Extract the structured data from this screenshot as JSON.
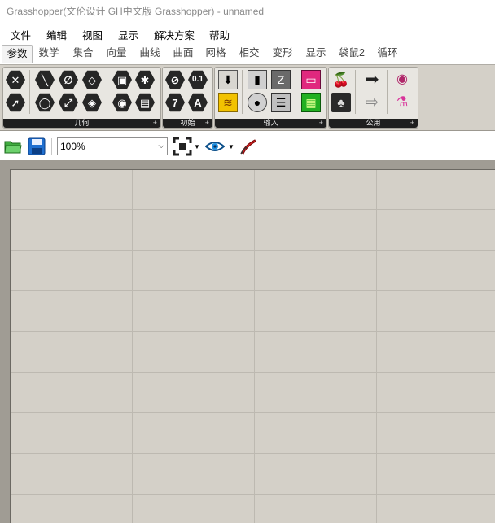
{
  "window": {
    "title": "Grasshopper(文伦设计 GH中文版 Grasshopper) - unnamed"
  },
  "menu": [
    "文件",
    "编辑",
    "视图",
    "显示",
    "解决方案",
    "帮助"
  ],
  "tabs": [
    "参数",
    "数学",
    "集合",
    "向量",
    "曲线",
    "曲面",
    "网格",
    "相交",
    "变形",
    "显示",
    "袋鼠2",
    "循环"
  ],
  "active_tab": "参数",
  "ribbon": {
    "panels": [
      {
        "label": "几何"
      },
      {
        "label": "初始"
      },
      {
        "label": "输入"
      },
      {
        "label": "公用"
      }
    ],
    "glyphs": {
      "num": "0.1",
      "seven": "7",
      "letter_a": "A"
    }
  },
  "toolbar": {
    "zoom_value": "100%"
  },
  "colors": {
    "canvas": "#d4d0c8",
    "grid": "#bdb9b1",
    "panel_footer": "#1f1f1f",
    "icon_dark": "#262626"
  }
}
